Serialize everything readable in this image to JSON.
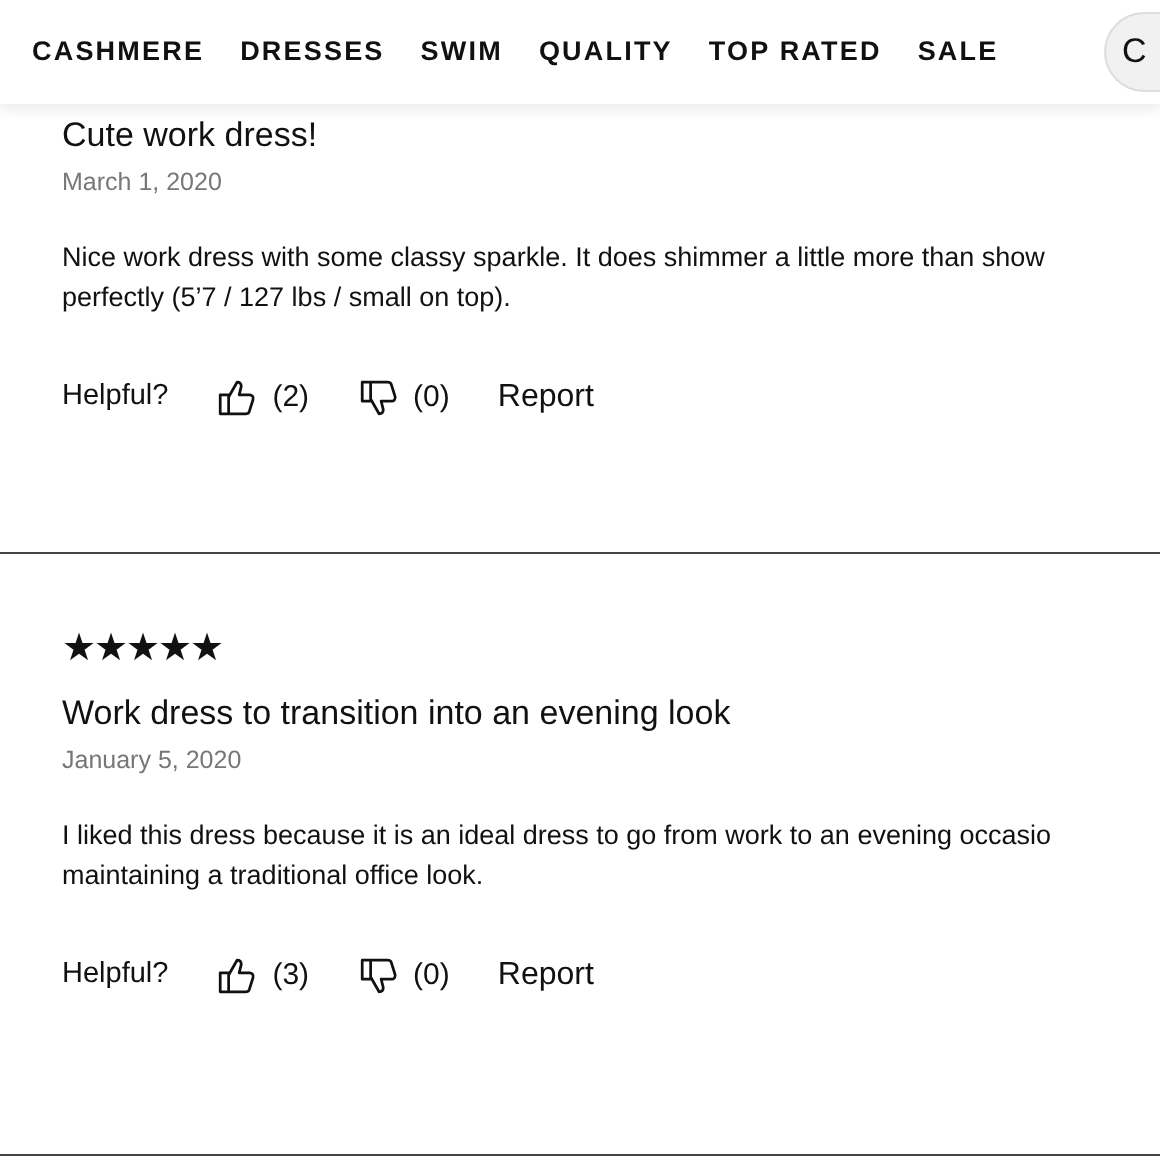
{
  "nav": {
    "items": [
      "CASHMERE",
      "DRESSES",
      "SWIM",
      "QUALITY",
      "TOP RATED",
      "SALE"
    ],
    "search_text": "C"
  },
  "reviews": [
    {
      "title": "Cute work dress!",
      "date": "March 1, 2020",
      "body": [
        "Nice work dress with some classy sparkle. It does shimmer a little more than show",
        "perfectly (5’7 / 127 lbs / small on top)."
      ],
      "helpful_label": "Helpful?",
      "up_count": "(2)",
      "down_count": "(0)",
      "report": "Report"
    },
    {
      "stars": 5,
      "title": "Work dress to transition into an evening look",
      "date": "January 5, 2020",
      "body": [
        "I liked this dress because it is an ideal dress to go from work to an evening occasio",
        "maintaining a traditional office look."
      ],
      "helpful_label": "Helpful?",
      "up_count": "(3)",
      "down_count": "(0)",
      "report": "Report"
    }
  ]
}
